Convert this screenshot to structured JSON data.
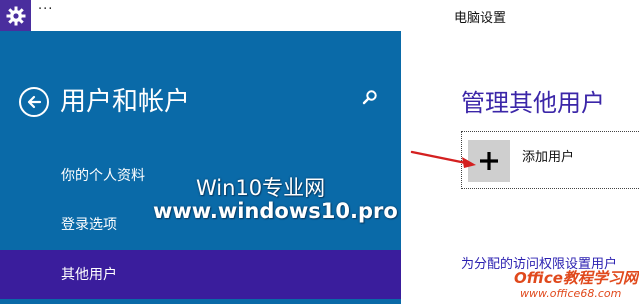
{
  "window": {
    "title": "电脑设置",
    "menu_dots": "···"
  },
  "left_pane": {
    "title": "用户和帐户",
    "nav_items": [
      {
        "label": "你的个人资料",
        "selected": false
      },
      {
        "label": "登录选项",
        "selected": false
      },
      {
        "label": "其他用户",
        "selected": true
      }
    ]
  },
  "right_pane": {
    "section_title": "管理其他用户",
    "add_user_label": "添加用户",
    "access_link": "为分配的访问权限设置用户"
  },
  "watermark": {
    "line1": "Win10专业网",
    "line2": "www.windows10.pro"
  },
  "corner_watermark": {
    "line1": "Office教程学习网",
    "line2": "www.office68.com"
  },
  "colors": {
    "accent_blue": "#0a6aa8",
    "selected_purple": "#3a1d9c",
    "title_purple": "#3b26a8",
    "arrow_red": "#d42020"
  },
  "icons": {
    "settings": "gear-icon",
    "back": "back-arrow-icon",
    "search": "search-icon",
    "add": "plus-icon"
  }
}
